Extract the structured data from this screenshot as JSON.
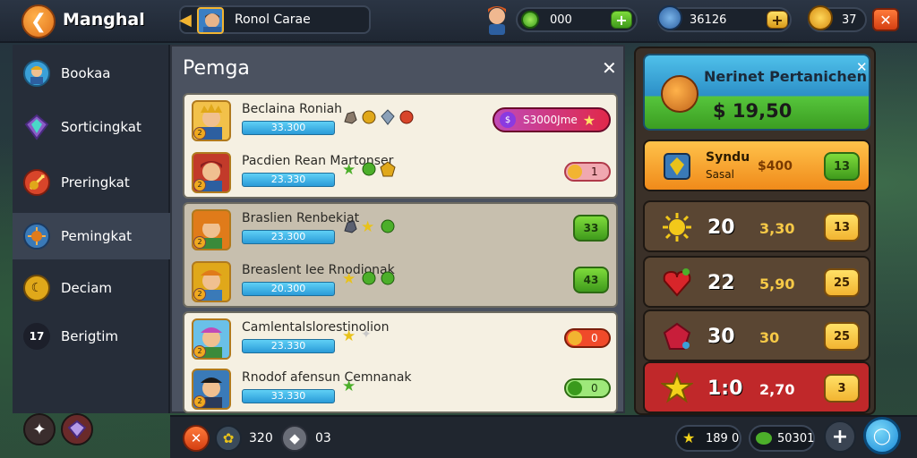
{
  "header": {
    "title": "Manghal",
    "player_name": "Ronol Carae",
    "resources": [
      {
        "icon": "green-gem-icon",
        "value": "000"
      },
      {
        "icon": "player-rank-icon",
        "value": "36126"
      },
      {
        "icon": "gold-coin-icon",
        "value": "37"
      }
    ]
  },
  "sidebar": {
    "items": [
      {
        "label": "Bookaa",
        "icon": "hero-portrait-icon",
        "color": "#3aa0d8"
      },
      {
        "label": "Sorticingkat",
        "icon": "crystal-icon",
        "color": "#8a5cc6"
      },
      {
        "label": "Preringkat",
        "icon": "sword-shield-icon",
        "color": "#d8452a"
      },
      {
        "label": "Pemingkat",
        "icon": "sun-badge-icon",
        "color": "#e07b1a"
      },
      {
        "label": "Deciam",
        "icon": "moon-icon",
        "color": "#e0a81a"
      },
      {
        "label": "Berigtim",
        "icon": "number-badge-icon",
        "color": "#2b2b3a",
        "badge": "17"
      }
    ]
  },
  "panel": {
    "title": "Pemga",
    "rows": [
      {
        "name": "Beclaina Roniah",
        "bar": "33.300",
        "avatar": "#e0a81a"
      },
      {
        "name": "Pacdien Rean Martonser",
        "bar": "23.330",
        "avatar": "#c23a2a"
      },
      {
        "name": "Braslien Renbekiat",
        "bar": "23.300",
        "avatar": "#e07b1a"
      },
      {
        "name": "Breaslent Iee Rnodionak",
        "bar": "20.300",
        "avatar": "#e0a81a"
      },
      {
        "name": "Camlentalslorestinolion",
        "bar": "23.330",
        "avatar": "#c04ab8"
      },
      {
        "name": "Rnodof afensun Cemnanak",
        "bar": "33.330",
        "avatar": "#2a3a5a"
      }
    ],
    "actions": {
      "row1_pill": "S3000Jme",
      "row2_pill": "1",
      "row3_btn": "33",
      "row4_btn": "43",
      "row5_pill": "0",
      "row6_pill": "0"
    }
  },
  "shop": {
    "header_title": "Nerinet Pertanichen",
    "header_price": "$ 19,50",
    "items": [
      {
        "num": "Syndu",
        "sub": "Sasal",
        "cost": "$400",
        "btn": "13",
        "bg": "#f2a422"
      },
      {
        "num": "20",
        "cost": "3,30",
        "btn": "13",
        "bg": "#5a4633"
      },
      {
        "num": "22",
        "cost": "5,90",
        "btn": "25",
        "bg": "#5a4633"
      },
      {
        "num": "30",
        "cost": "30",
        "btn": "25",
        "bg": "#5a4633"
      },
      {
        "num": "1:0",
        "cost": "2,70",
        "btn": "3",
        "bg": "#c0282a"
      }
    ]
  },
  "bottom": {
    "val1": "320",
    "val2": "03",
    "star_count": "189 0",
    "leaf_count": "50301"
  }
}
